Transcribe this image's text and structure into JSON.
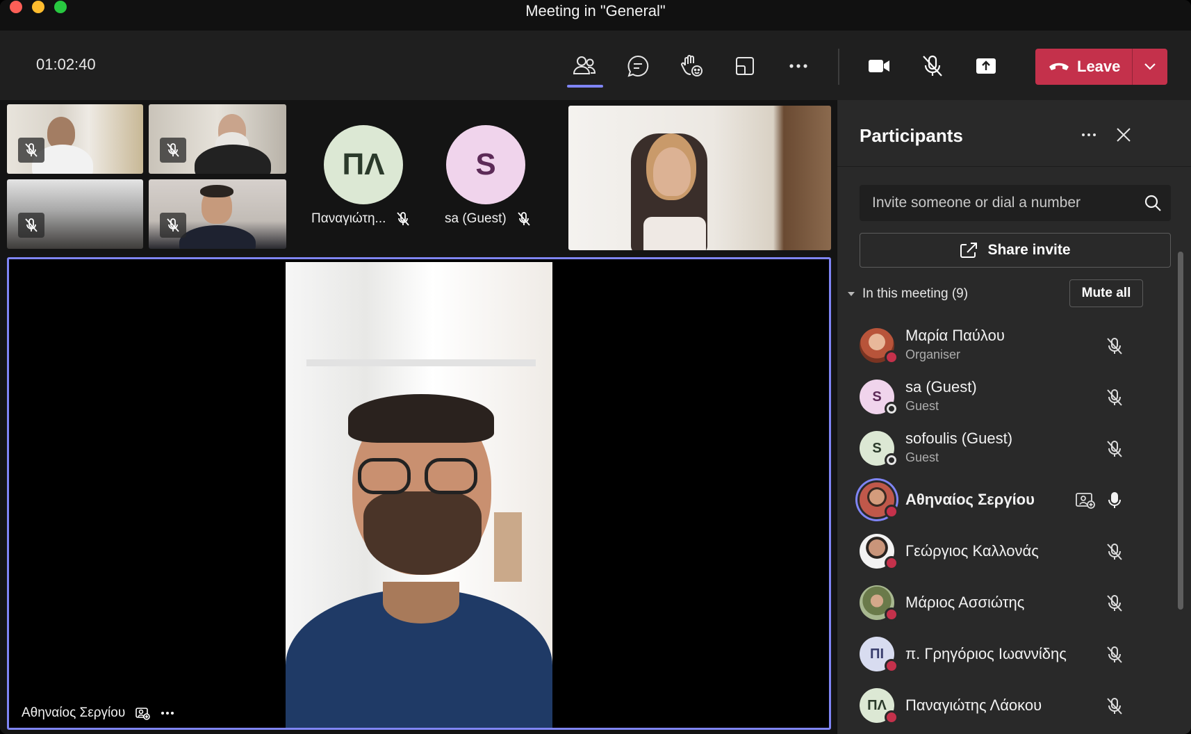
{
  "window": {
    "title": "Meeting in \"General\""
  },
  "toolbar": {
    "timer": "01:02:40",
    "icons": {
      "people": "people-icon",
      "chat": "chat-icon",
      "reactions": "raise-hand-icon",
      "rooms": "share-tray-icon",
      "more": "more-icon",
      "camera": "camera-icon",
      "mic": "mic-off-icon",
      "share": "share-screen-icon"
    },
    "leave_label": "Leave"
  },
  "stage": {
    "tiles": [
      {
        "kind": "video"
      },
      {
        "kind": "video"
      },
      {
        "kind": "video"
      },
      {
        "kind": "video"
      },
      {
        "kind": "avatar",
        "initials": "ΠΛ",
        "name": "Παναγιώτη...",
        "avatar_color": "#dce8d4",
        "text_color": "#2b3a2b"
      },
      {
        "kind": "avatar",
        "initials": "S",
        "name": "sa (Guest)",
        "avatar_color": "#f0d4ec",
        "text_color": "#5c2a57"
      },
      {
        "kind": "video"
      }
    ],
    "spotlight": {
      "name": "Αθηναίος Σεργίου"
    }
  },
  "panel": {
    "title": "Participants",
    "invite_placeholder": "Invite someone or dial a number",
    "share_invite_label": "Share invite",
    "section_label": "In this meeting (9)",
    "mute_all_label": "Mute all",
    "participants": [
      {
        "name": "Μαρία Παύλου",
        "role": "Organiser",
        "initials": "",
        "avatar_color": "#b85a3c",
        "status": "red",
        "mic": "off"
      },
      {
        "name": "sa (Guest)",
        "role": "Guest",
        "initials": "S",
        "avatar_color": "#f0d4ec",
        "text_color": "#5c2a57",
        "status": "offline",
        "mic": "off"
      },
      {
        "name": "sofoulis (Guest)",
        "role": "Guest",
        "initials": "S",
        "avatar_color": "#dce8d4",
        "text_color": "#2b3a2b",
        "status": "offline",
        "mic": "off"
      },
      {
        "name": "Αθηναίος Σεργίου",
        "role": "",
        "initials": "",
        "avatar_color": "#c0584a",
        "status": "red",
        "mic": "on",
        "speaking": true
      },
      {
        "name": "Γεώργιος Καλλονάς",
        "role": "",
        "initials": "",
        "avatar_color": "#6a5a52",
        "status": "red",
        "mic": "off"
      },
      {
        "name": "Μάριος Ασσιώτης",
        "role": "",
        "initials": "",
        "avatar_color": "#8a9a6a",
        "status": "red",
        "mic": "off"
      },
      {
        "name": "π. Γρηγόριος Ιωαννίδης",
        "role": "",
        "initials": "ΠΙ",
        "avatar_color": "#d8dcf0",
        "text_color": "#3a3f6e",
        "status": "red",
        "mic": "off"
      },
      {
        "name": "Παναγιώτης Λάοκου",
        "role": "",
        "initials": "ΠΛ",
        "avatar_color": "#dce8d4",
        "text_color": "#2b3a2b",
        "status": "red",
        "mic": "off"
      }
    ]
  }
}
